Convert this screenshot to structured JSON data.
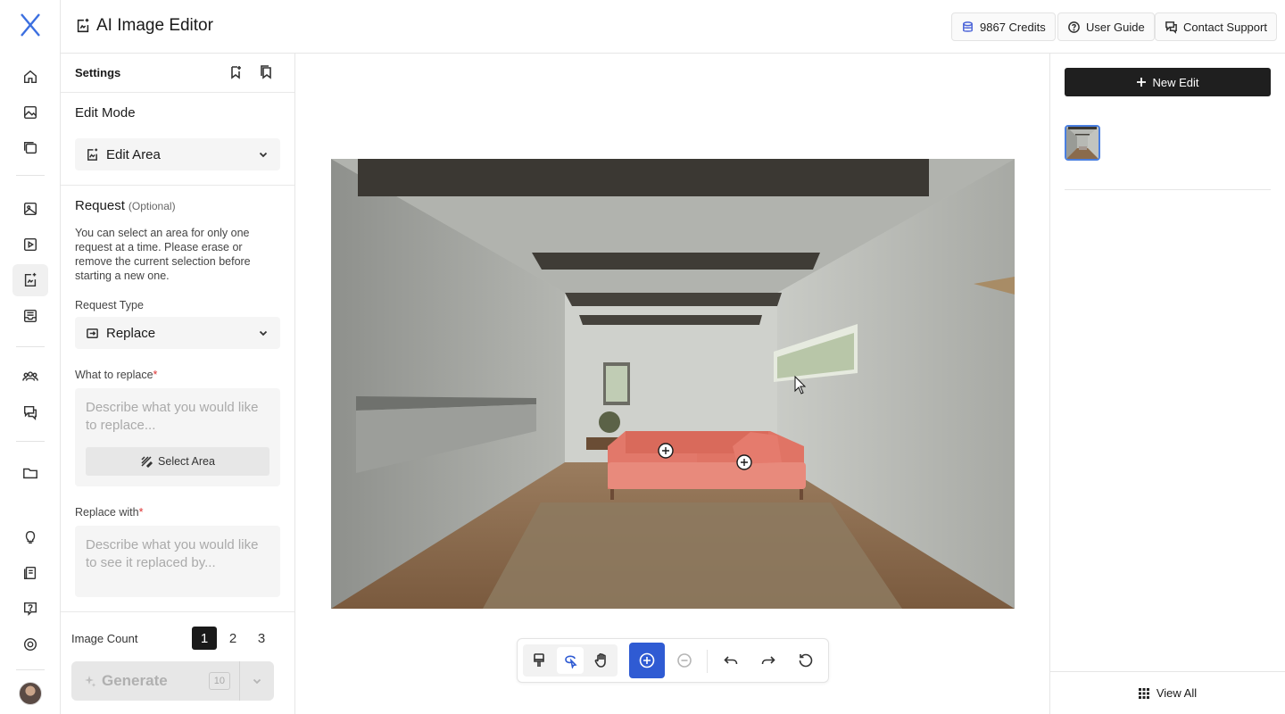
{
  "header": {
    "title": "AI Image Editor",
    "credits": "9867 Credits",
    "user_guide": "User Guide",
    "contact_support": "Contact Support"
  },
  "rail": {
    "icons": [
      "home-icon",
      "gallery-icon",
      "collections-icon",
      "image-icon",
      "video-icon",
      "image-edit-icon",
      "inbox-icon",
      "team-icon",
      "chat-icon",
      "folder-icon",
      "lightbulb-icon",
      "book-icon",
      "help-icon",
      "settings-circle-icon"
    ],
    "active": "image-edit-icon"
  },
  "settings": {
    "title": "Settings",
    "edit_mode_title": "Edit Mode",
    "edit_mode_value": "Edit Area",
    "request_title": "Request",
    "request_optional": "(Optional)",
    "request_description": "You can select an area for only one request at a time. Please erase or remove the current selection before starting a new one.",
    "request_type_label": "Request Type",
    "request_type_value": "Replace",
    "what_to_replace_label": "What to replace",
    "what_to_replace_placeholder": "Describe what you would like to replace...",
    "select_area_label": "Select Area",
    "replace_with_label": "Replace with",
    "replace_with_placeholder": "Describe what you would like to see it replaced by...",
    "required_mark": "*"
  },
  "footer": {
    "image_count_label": "Image Count",
    "counts": [
      "1",
      "2",
      "3"
    ],
    "selected_count": "1",
    "generate_label": "Generate",
    "generate_cost": "10"
  },
  "right_panel": {
    "new_edit_label": "New Edit",
    "view_all_label": "View All"
  },
  "toolbar": {
    "tools": [
      "brush-tool-icon",
      "lasso-select-icon",
      "hand-pan-icon",
      "zoom-in-icon",
      "zoom-out-icon",
      "undo-icon",
      "redo-icon",
      "reset-icon"
    ],
    "active": "zoom-in-icon"
  },
  "colors": {
    "accent": "#2f5bd3",
    "primary_button": "#1f1f1f",
    "sofa": "#e2786a",
    "required": "#dd3333"
  }
}
